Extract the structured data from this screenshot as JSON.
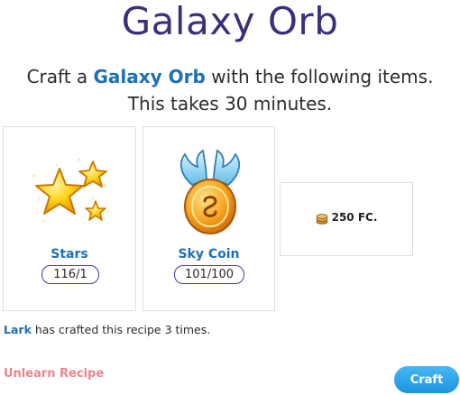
{
  "title": "Galaxy Orb",
  "description": {
    "prefix": "Craft a ",
    "item": "Galaxy Orb",
    "suffix": " with the following items. This takes 30 minutes."
  },
  "ingredients": [
    {
      "name": "Stars",
      "quantity": "116/1",
      "icon": "stars-icon"
    },
    {
      "name": "Sky Coin",
      "quantity": "101/100",
      "icon": "sky-coin-icon"
    }
  ],
  "fee": {
    "amount": "250 FC.",
    "icon": "coin-stack-icon"
  },
  "crafted": {
    "user": "Lark",
    "text": " has crafted this recipe 3 times."
  },
  "unlearn_label": "Unlearn Recipe",
  "craft_label": "Craft",
  "colors": {
    "title": "#3b2f7a",
    "link": "#1f6fb6",
    "unlearn": "#e8868c",
    "button": "#1b95e0"
  }
}
